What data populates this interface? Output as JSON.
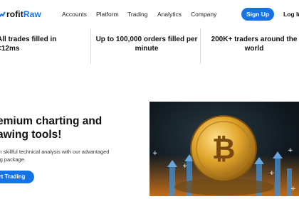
{
  "brand": {
    "name_part1": "rofit",
    "name_part2": "Raw"
  },
  "nav": {
    "items": [
      {
        "label": "Accounts"
      },
      {
        "label": "Platform"
      },
      {
        "label": "Trading"
      },
      {
        "label": "Analytics"
      },
      {
        "label": "Company"
      }
    ],
    "signup_label": "Sign Up",
    "login_label": "Log In"
  },
  "stats": [
    {
      "line1": "All trades filled in <12ms",
      "line2": ""
    },
    {
      "line1": "Up to 100,000 orders filled per",
      "line2": "minute"
    },
    {
      "line1": "200K+ traders around the",
      "line2": "world"
    }
  ],
  "hero": {
    "title_line1": "emium charting and",
    "title_line2": "awing tools!",
    "subtitle_line1": "rm skillful technical analysis with our advantaged",
    "subtitle_line2": "ing package.",
    "cta_label": "rt Trading",
    "image_icon": "bitcoin-coin-image"
  },
  "colors": {
    "accent": "#1673e6",
    "text": "#111111",
    "divider": "#d8dbe0"
  }
}
